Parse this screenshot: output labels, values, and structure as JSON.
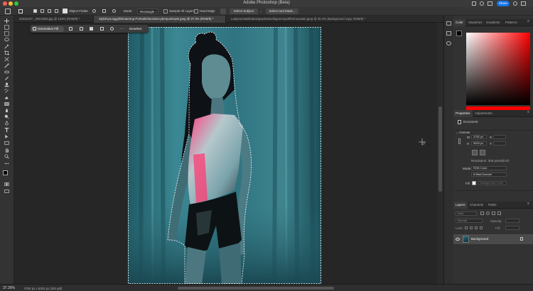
{
  "app": {
    "title": "Adobe Photoshop (Beta)",
    "share_label": "Share"
  },
  "options_bar": {
    "object_finder_label": "Object Finder",
    "mode_label": "Mode:",
    "mode_value": "Rectangle",
    "sample_all_layers_label": "Sample All Layers",
    "hard_edge_label": "Hard Edge",
    "select_subject_label": "Select Subject",
    "select_and_mask_label": "Select and Mask..."
  },
  "tabs": [
    {
      "label": "20231107-_D5C9363.jpg @ 134% (RGB/8) *",
      "active": false
    },
    {
      "label": "Stylishyounggirlinleatertop.Portraitinfuturisticcyberpunkstyle.jpeg @ 37.3% (RGB/8) *",
      "active": true
    },
    {
      "label": "Ladytouristwithabackpackstandingonmopofthemountain.jpeg @ 45.4% (Background copy, RGB/8) *",
      "active": false
    }
  ],
  "context_bar": {
    "generative_fill_label": "Generative Fill",
    "deselect_label": "Deselect"
  },
  "status": {
    "zoom": "37.26%",
    "doc_info": "3782 px x 5003 px (300 ppi)"
  },
  "color_panel": {
    "tabs": [
      "Color",
      "Swatches",
      "Gradients",
      "Patterns"
    ],
    "foreground": "#000000",
    "background": "#ffffff",
    "hue_color": "#ff0000"
  },
  "properties_panel": {
    "tabs": [
      "Properties",
      "Adjustments"
    ],
    "document_label": "Document",
    "canvas_label": "Canvas",
    "width_label": "W",
    "width_value": "3782 px",
    "x_label": "X",
    "height_label": "H",
    "height_value": "5003 px",
    "y_label": "Y",
    "resolution_text": "Resolution: 300 pixels/inch",
    "mode_label": "Mode",
    "mode_value": "RGB Color",
    "depth_value": "8 Bits/Channel",
    "fill_label": "Fill",
    "fill_value": "Background Color"
  },
  "layers_panel": {
    "tabs": [
      "Layers",
      "Channels",
      "Paths"
    ],
    "kind_placeholder": "Kind",
    "blend_mode": "Normal",
    "opacity_label": "Opacity:",
    "lock_label": "Lock:",
    "fill_label": "Fill:",
    "layers": [
      {
        "name": "Background",
        "visible": true,
        "locked": true
      }
    ]
  },
  "colors": {
    "accent": "#1473e6",
    "ui_dark": "#323232",
    "selection": "#ffffff"
  }
}
